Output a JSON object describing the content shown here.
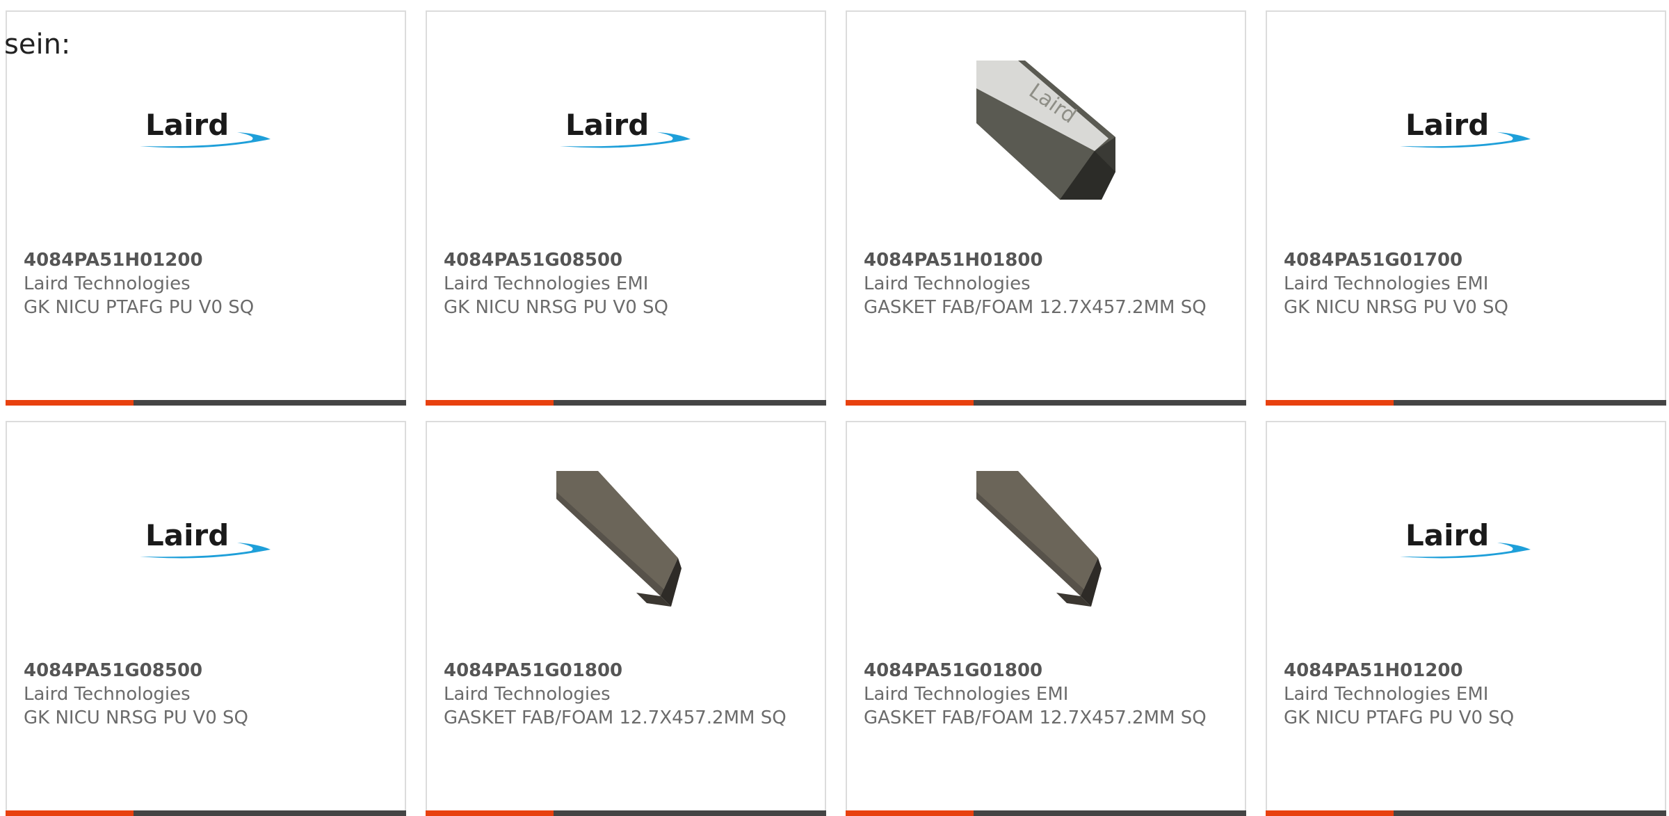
{
  "intro_text": "sein:",
  "colors": {
    "accent": "#e8410f",
    "bar": "#454545",
    "logo_blue": "#1e9fd9",
    "logo_text": "#1a1a1a"
  },
  "products": [
    {
      "part_number": "4084PA51H01200",
      "manufacturer": "Laird Technologies",
      "description": "GK NICU PTAFG PU V0 SQ",
      "image": "laird-logo",
      "logo_text": "Laird"
    },
    {
      "part_number": "4084PA51G08500",
      "manufacturer": "Laird Technologies EMI",
      "description": "GK NICU NRSG PU V0 SQ",
      "image": "laird-logo",
      "logo_text": "Laird"
    },
    {
      "part_number": "4084PA51H01800",
      "manufacturer": "Laird Technologies",
      "description": "GASKET FAB/FOAM 12.7X457.2MM SQ",
      "image": "gasket-strip-photo",
      "logo_text": "Laird"
    },
    {
      "part_number": "4084PA51G01700",
      "manufacturer": "Laird Technologies EMI",
      "description": "GK NICU NRSG PU V0 SQ",
      "image": "laird-logo",
      "logo_text": "Laird"
    },
    {
      "part_number": "4084PA51G08500",
      "manufacturer": "Laird Technologies",
      "description": "GK NICU NRSG PU V0 SQ",
      "image": "laird-logo",
      "logo_text": "Laird"
    },
    {
      "part_number": "4084PA51G01800",
      "manufacturer": "Laird Technologies",
      "description": "GASKET FAB/FOAM 12.7X457.2MM SQ",
      "image": "gasket-bar-photo",
      "logo_text": ""
    },
    {
      "part_number": "4084PA51G01800",
      "manufacturer": "Laird Technologies EMI",
      "description": "GASKET FAB/FOAM 12.7X457.2MM SQ",
      "image": "gasket-bar-photo",
      "logo_text": ""
    },
    {
      "part_number": "4084PA51H01200",
      "manufacturer": "Laird Technologies EMI",
      "description": "GK NICU PTAFG PU V0 SQ",
      "image": "laird-logo",
      "logo_text": "Laird"
    }
  ]
}
